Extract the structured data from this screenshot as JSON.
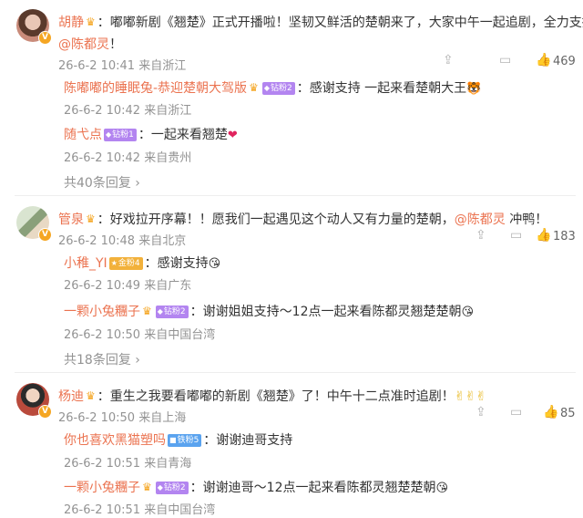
{
  "comments": [
    {
      "user": "胡静",
      "body_prefix": "：嘟嘟新剧《翘楚》正式开播啦！坚韧又鲜活的楚朝来了，大家中午一起追剧，全力支持",
      "mention": "@陈都灵",
      "body_suffix": "！",
      "time": "26-6-2 10:41",
      "location": "来自浙江",
      "likes": "469",
      "replies": [
        {
          "user": "陈嘟嘟的睡眠兔-恭迎楚朝大驾版",
          "badge": "钻粉2",
          "body": "：感谢支持 一起来看楚朝大王",
          "emoji": "🐯",
          "time": "26-6-2 10:42",
          "location": "来自浙江"
        },
        {
          "user": "随弋点",
          "badge": "钻粉1",
          "body": "：一起来看翘楚",
          "emoji": "❤",
          "time": "26-6-2 10:42",
          "location": "来自贵州"
        }
      ],
      "more": "共40条回复"
    },
    {
      "user": "管泉",
      "body_prefix": "：好戏拉开序幕！！愿我们一起遇见这个动人又有力量的楚朝，",
      "mention": "@陈都灵",
      "body_suffix": " 冲鸭！",
      "time": "26-6-2 10:48",
      "location": "来自北京",
      "likes": "183",
      "replies": [
        {
          "user": "小稚_YI",
          "badge": "金粉4",
          "body": "：感谢支持",
          "emoji": "😘",
          "time": "26-6-2 10:49",
          "location": "来自广东"
        },
        {
          "user": "一颗小兔糰子",
          "badge": "钻粉2",
          "body": "：谢谢姐姐支持～12点一起来看陈都灵翘楚楚朝",
          "emoji": "😘",
          "time": "26-6-2 10:50",
          "location": "来自中国台湾"
        }
      ],
      "more": "共18条回复"
    },
    {
      "user": "杨迪",
      "body_prefix": "：重生之我要看嘟嘟的新剧《翘楚》了！中午十二点准时追剧！",
      "mention": "",
      "body_suffix": "✌✌✌",
      "time": "26-6-2 10:50",
      "location": "来自上海",
      "likes": "85",
      "replies": [
        {
          "user": "你也喜欢黑猫塑吗",
          "badge": "铁粉5",
          "body": "：谢谢迪哥支持",
          "emoji": "",
          "time": "26-6-2 10:51",
          "location": "来自青海"
        },
        {
          "user": "一颗小兔糰子",
          "badge": "钻粉2",
          "body": "：谢谢迪哥～12点一起来看陈都灵翘楚楚朝",
          "emoji": "😘",
          "time": "26-6-2 10:51",
          "location": "来自中国台湾"
        }
      ]
    }
  ],
  "icons": {
    "share": "share-icon",
    "comment": "comment-icon",
    "like": "like-icon"
  },
  "colors": {
    "username": "#eb7350",
    "meta": "#939393",
    "diamond_badge": "#b385f0",
    "gold_badge": "#f2b13b",
    "iron_badge": "#5aa3ef"
  }
}
